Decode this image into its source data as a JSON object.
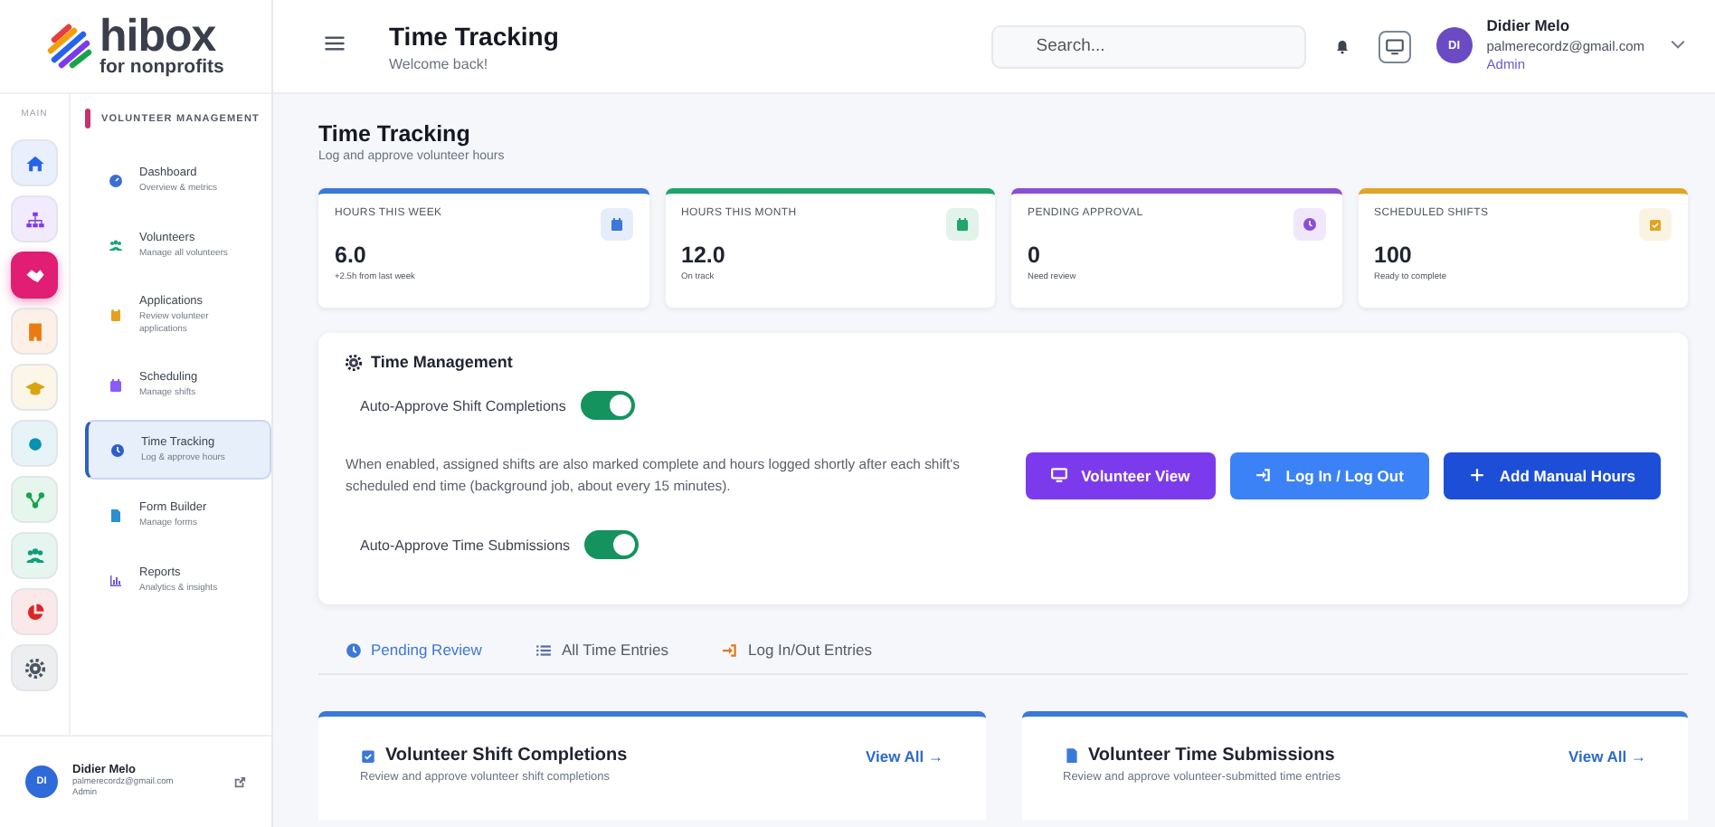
{
  "brand": {
    "name": "hibox",
    "tagline": "for nonprofits"
  },
  "header": {
    "title": "Time Tracking",
    "subtitle": "Welcome back!",
    "search_placeholder": "Search...",
    "user": {
      "initials": "DI",
      "name": "Didier Melo",
      "email": "palmerecordz@gmail.com",
      "role": "Admin"
    }
  },
  "rail": {
    "label": "MAIN",
    "items": [
      {
        "color": "#2563eb",
        "selected": false
      },
      {
        "color": "#7c3aed",
        "selected": false
      },
      {
        "color": "#e11d74",
        "selected": true
      },
      {
        "color": "#ea7a12",
        "selected": false
      },
      {
        "color": "#d9a410",
        "selected": false
      },
      {
        "color": "#0891b2",
        "selected": false
      },
      {
        "color": "#16a34a",
        "selected": false
      },
      {
        "color": "#0f9f7a",
        "selected": false
      },
      {
        "color": "#dc2626",
        "selected": false
      },
      {
        "color": "#4b5563",
        "selected": false
      }
    ]
  },
  "section": {
    "title": "VOLUNTEER MANAGEMENT",
    "items": [
      {
        "label": "Dashboard",
        "description": "Overview & metrics",
        "selected": false
      },
      {
        "label": "Volunteers",
        "description": "Manage all volunteers",
        "selected": false
      },
      {
        "label": "Applications",
        "description": "Review volunteer applications",
        "selected": false
      },
      {
        "label": "Scheduling",
        "description": "Manage shifts",
        "selected": false
      },
      {
        "label": "Time Tracking",
        "description": "Log & approve hours",
        "selected": true
      },
      {
        "label": "Form Builder",
        "description": "Manage forms",
        "selected": false
      },
      {
        "label": "Reports",
        "description": "Analytics & insights",
        "selected": false
      }
    ]
  },
  "sidebar_user": {
    "initials": "DI",
    "name": "Didier Melo",
    "email": "palmerecordz@gmail.com",
    "role": "Admin"
  },
  "page": {
    "title": "Time Tracking",
    "subtitle": "Log and approve volunteer hours"
  },
  "stats": [
    {
      "label": "HOURS THIS WEEK",
      "value": "6.0",
      "note": "+2.5h from last week",
      "color": "#3b78d8"
    },
    {
      "label": "HOURS THIS MONTH",
      "value": "12.0",
      "note": "On track",
      "color": "#20a56a"
    },
    {
      "label": "PENDING APPROVAL",
      "value": "0",
      "note": "Need review",
      "color": "#8b4fd6"
    },
    {
      "label": "SCHEDULED SHIFTS",
      "value": "100",
      "note": "Ready to complete",
      "color": "#e0a526"
    }
  ],
  "time_management": {
    "title": "Time Management",
    "settings": [
      {
        "label": "Auto-Approve Shift Completions",
        "on": true
      },
      {
        "label": "Auto-Approve Time Submissions",
        "on": true
      }
    ],
    "description": "When enabled, assigned shifts are also marked complete and hours logged shortly after each shift's scheduled end time (background job, about every 15 minutes).",
    "buttons": [
      {
        "label": "Volunteer View",
        "color": "#7c3aed"
      },
      {
        "label": "Log In / Log Out",
        "color": "#3b82f6"
      },
      {
        "label": "Add Manual Hours",
        "color": "#1d4ed8"
      }
    ]
  },
  "tabs": [
    {
      "label": "Pending Review",
      "selected": true
    },
    {
      "label": "All Time Entries",
      "selected": false
    },
    {
      "label": "Log In/Out Entries",
      "selected": false
    }
  ],
  "panels": [
    {
      "title": "Volunteer Shift Completions",
      "subtitle": "Review and approve volunteer shift completions",
      "link": "View All →"
    },
    {
      "title": "Volunteer Time Submissions",
      "subtitle": "Review and approve volunteer-submitted time entries",
      "link": "View All →"
    }
  ]
}
